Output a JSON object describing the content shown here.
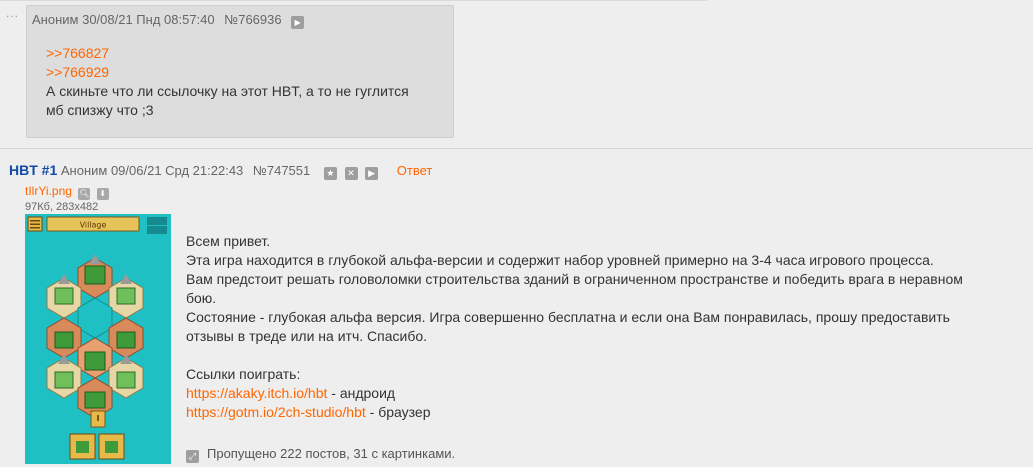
{
  "reply_post": {
    "author": "Аноним",
    "datetime": "30/08/21 Пнд 08:57:40",
    "number": "№766936",
    "refs": [
      ">>766827",
      ">>766929"
    ],
    "lines": [
      "А скиньте что ли ссылочку на этот HBT, а то не гуглится",
      "мб спизжу что ;3"
    ]
  },
  "op_post": {
    "title": "HBT #1",
    "author": "Аноним",
    "datetime": "09/06/21 Срд 21:22:43",
    "number": "№747551",
    "answer_label": "Ответ",
    "file": {
      "name": "tIlrYi.png",
      "meta": "97Кб, 283x482",
      "thumb_title": "Village"
    },
    "text_lines": [
      "Всем привет.",
      "Эта игра находится в глубокой альфа-версии и содержит набор уровней примерно на 3-4 часа игрового процесса.",
      "Вам предстоит решать головоломки строительства зданий в ограниченном пространстве и победить врага в неравном",
      "бою.",
      "Состояние - глубокая альфа версия. Игра совершенно бесплатна и если она Вам понравилась, прошу предоставить",
      "отзывы в треде или на итч. Спасибо."
    ],
    "links_header": "Ссылки поиграть:",
    "links": [
      {
        "url": "https://akaky.itch.io/hbt",
        "suffix": " - андроид"
      },
      {
        "url": "https://gotm.io/2ch-studio/hbt",
        "suffix": " - браузер"
      }
    ],
    "skipped": "Пропущено 222 постов, 31 с картинками."
  }
}
